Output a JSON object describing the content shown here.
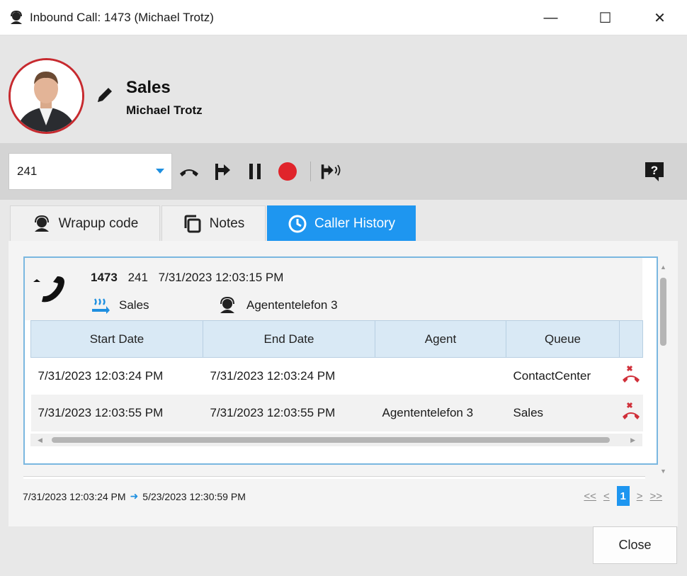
{
  "window": {
    "title": "Inbound Call: 1473 (Michael Trotz)",
    "minimize": "—",
    "maximize": "☐",
    "close": "✕"
  },
  "header": {
    "queue": "Sales",
    "caller": "Michael Trotz"
  },
  "toolbar": {
    "extension_value": "241"
  },
  "tabs": [
    {
      "label": "Wrapup code",
      "icon": "headset-icon"
    },
    {
      "label": "Notes",
      "icon": "notes-icon"
    },
    {
      "label": "Caller History",
      "icon": "clock-icon",
      "active": true
    }
  ],
  "history": {
    "call": {
      "number": "1473",
      "extension": "241",
      "datetime": "7/31/2023 12:03:15 PM",
      "queue": "Sales",
      "agent": "Agententelefon 3"
    },
    "columns": [
      "Start Date",
      "End Date",
      "Agent",
      "Queue"
    ],
    "rows": [
      {
        "start": "7/31/2023 12:03:24 PM",
        "end": "7/31/2023 12:03:24 PM",
        "agent": "",
        "queue": "ContactCenter"
      },
      {
        "start": "7/31/2023 12:03:55 PM",
        "end": "7/31/2023 12:03:55 PM",
        "agent": "Agententelefon 3",
        "queue": "Sales"
      }
    ]
  },
  "range": {
    "from": "7/31/2023 12:03:24 PM",
    "to": "5/23/2023 12:30:59 PM"
  },
  "pager": {
    "first": "<<",
    "prev": "<",
    "current": "1",
    "next": ">",
    "last": ">>"
  },
  "footer": {
    "close_label": "Close"
  },
  "colors": {
    "accent": "#1e96f0",
    "record": "#e0242b",
    "hangup": "#d0303a",
    "avatar_ring": "#c72a2f"
  }
}
